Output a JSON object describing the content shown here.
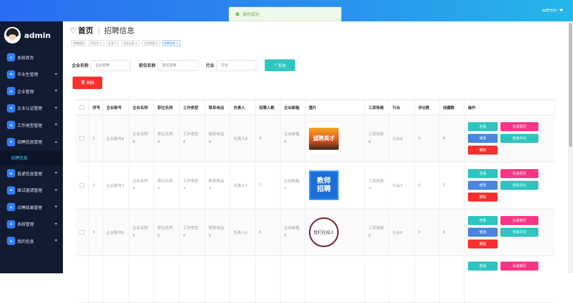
{
  "topbar": {
    "user": "admin"
  },
  "toast": {
    "text": "操作成功"
  },
  "sidebar": {
    "brand": "admin",
    "items": [
      {
        "label": "系统首页",
        "icon": "home-icon"
      },
      {
        "label": "毕业生管理",
        "icon": "grid-icon"
      },
      {
        "label": "企业管理",
        "icon": "grid-icon"
      },
      {
        "label": "企业认证管理",
        "icon": "grid-icon"
      },
      {
        "label": "工作类型管理",
        "icon": "grid-icon"
      },
      {
        "label": "招聘信息管理",
        "icon": "grid-icon",
        "open": true
      },
      {
        "label": "投递信息管理",
        "icon": "grid-icon"
      },
      {
        "label": "面试邀请管理",
        "icon": "grid-icon"
      },
      {
        "label": "应聘结果管理",
        "icon": "grid-icon"
      },
      {
        "label": "系统管理",
        "icon": "grid-icon"
      },
      {
        "label": "我的信息",
        "icon": "grid-icon"
      }
    ],
    "submenu": "招聘信息"
  },
  "page": {
    "title": "首页",
    "subtitle": "招聘信息"
  },
  "tags": [
    "系统首页",
    "毕业生 ×",
    "企业 ×",
    "企业认证 ×",
    "工作类型 ×",
    "招聘信息 ×"
  ],
  "search": {
    "company_label": "企业名称",
    "company_placeholder": "企业名称",
    "job_label": "职位名称",
    "job_placeholder": "职位名称",
    "industry_label": "行业",
    "industry_placeholder": "行业",
    "query_label": "查询"
  },
  "delete_label": "删除",
  "table": {
    "headers": [
      "序号",
      "企业账号",
      "企业名称",
      "职位名称",
      "工作类型",
      "联系电话",
      "负责人",
      "招聘人数",
      "企业邮箱",
      "图片",
      "工资待遇",
      "行业",
      "评论数",
      "收藏数",
      "操作"
    ],
    "rows": [
      {
        "idx": "1",
        "account": "企业账号8",
        "name1": "企业名称",
        "name2": "8",
        "job1": "职位名称",
        "job2": "8",
        "type1": "工作类型",
        "type2": "8",
        "tel1": "联系电话",
        "tel2": "8",
        "man": "负责人8",
        "num": "8",
        "mail1": "企业邮箱",
        "mail2": "8",
        "img": "诚聘英才",
        "sal1": "工资待遇",
        "sal2": "8",
        "ind": "行业8",
        "cmt": "0",
        "fav": "8"
      },
      {
        "idx": "2",
        "account": "企业账号7",
        "name1": "企业名称",
        "name2": "7",
        "job1": "职位名称",
        "job2": "7",
        "type1": "工作类型",
        "type2": "7",
        "tel1": "联系电话",
        "tel2": "7",
        "man": "负责人7",
        "num": "7",
        "mail1": "企业邮箱",
        "mail2": "7",
        "img1": "教师",
        "img2": "招聘",
        "sal1": "工资待遇",
        "sal2": "7",
        "ind": "行业7",
        "cmt": "0",
        "fav": "7"
      },
      {
        "idx": "3",
        "account": "企业账号6",
        "name1": "企业名称",
        "name2": "6",
        "job1": "职位名称",
        "job2": "6",
        "type1": "工作类型",
        "type2": "6",
        "tel1": "联系电话",
        "tel2": "6",
        "man": "负责人6",
        "num": "6",
        "mail1": "企业邮箱",
        "mail2": "6",
        "img": "我们在招人",
        "sal1": "工资待遇",
        "sal2": "6",
        "ind": "行业6",
        "cmt": "0",
        "fav": "6"
      }
    ],
    "ops": {
      "view": "查看",
      "apply": "投递简历",
      "edit": "修改",
      "comments": "查看评论",
      "delete": "删除"
    }
  }
}
